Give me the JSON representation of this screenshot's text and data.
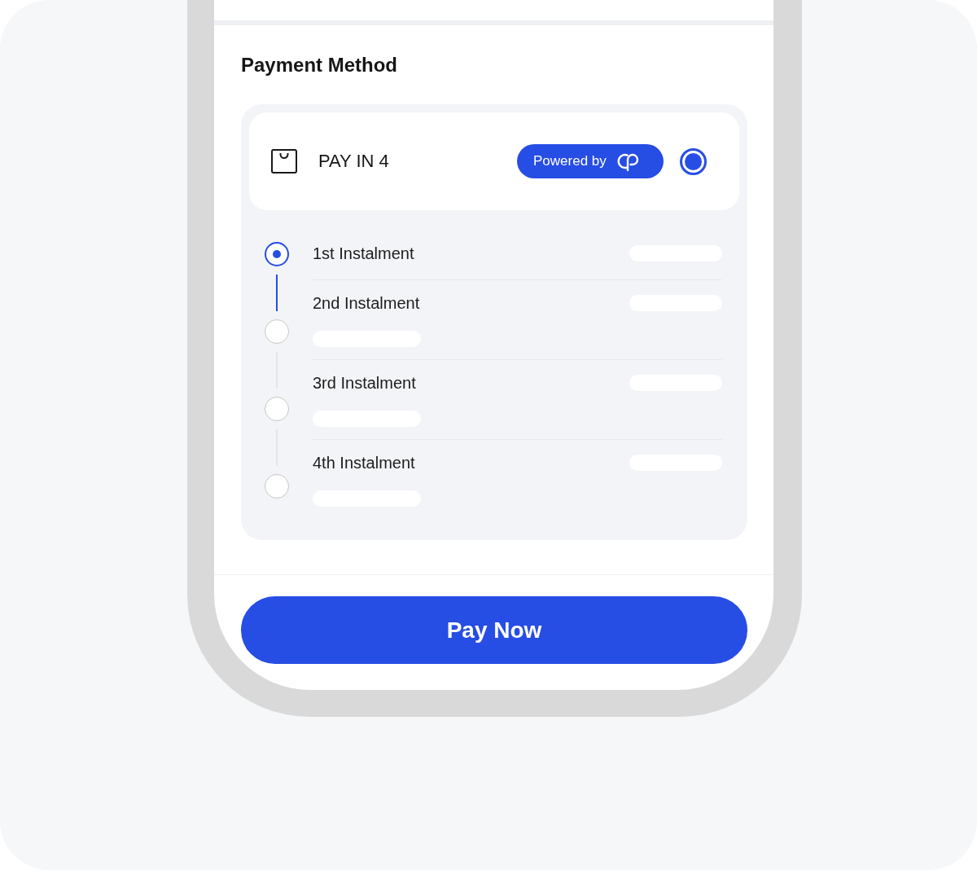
{
  "section_title": "Payment Method",
  "payment_option": {
    "label": "PAY IN 4",
    "badge": "Powered by",
    "selected": true,
    "instalments": [
      {
        "label": "1st Instalment",
        "kind": "current",
        "selected": true,
        "loading": true
      },
      {
        "label": "2nd Instalment",
        "kind": "upcoming",
        "selected": false,
        "loading": true
      },
      {
        "label": "3rd Instalment",
        "kind": "upcoming",
        "selected": false,
        "loading": true
      },
      {
        "label": "4th Instalment",
        "kind": "upcoming",
        "selected": false,
        "loading": true
      }
    ]
  },
  "pay_button": {
    "label": "Pay Now"
  }
}
